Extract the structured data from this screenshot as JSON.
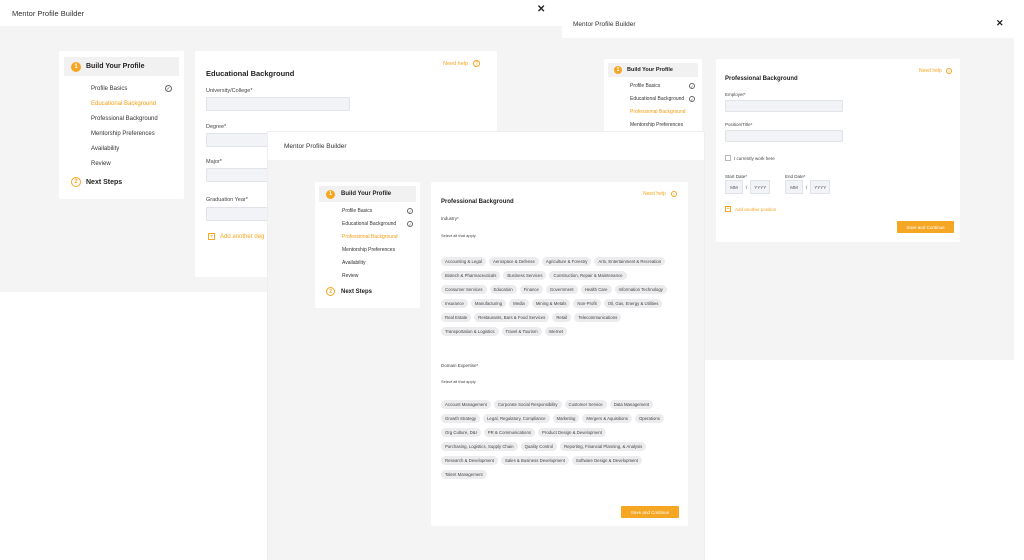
{
  "app_title": "Mentor Profile Builder",
  "close_glyph": "✕",
  "steps": {
    "build": "Build Your Profile",
    "build_num": "1",
    "next": "Next Steps",
    "next_num": "2",
    "items": [
      "Profile Basics",
      "Educational Background",
      "Professional Background",
      "Mentorship Preferences",
      "Availability",
      "Review"
    ]
  },
  "help": "Need help",
  "help_glyph": "?",
  "check_glyph": "✓",
  "plus_glyph": "+",
  "edu": {
    "title": "Educational Background",
    "university": "University/College*",
    "degree": "Degree*",
    "major": "Major*",
    "grad_year": "Graduation Year*",
    "add": "Add another deg"
  },
  "prof": {
    "title": "Professional Background",
    "industry": "Industry*",
    "select_all": "Select all that apply",
    "industries": [
      "Accounting & Legal",
      "Aerospace & Defense",
      "Agriculture & Forestry",
      "Arts, Entertainment & Recreation",
      "Biotech & Pharmaceuticals",
      "Business Services",
      "Construction, Repair & Maintenance",
      "Consumer Services",
      "Education",
      "Finance",
      "Government",
      "Health Care",
      "Information Technology",
      "Insurance",
      "Manufacturing",
      "Media",
      "Mining & Metals",
      "Non-Profit",
      "Oil, Gas, Energy & Utilities",
      "Real Estate",
      "Restaurants, Bars & Food Services",
      "Retail",
      "Telecommunications",
      "Transportation & Logistics",
      "Travel & Tourism",
      "Internet"
    ],
    "domain": "Domain Expertise*",
    "domains": [
      "Account Management",
      "Corporate Social Responsibility",
      "Customer Service",
      "Data Management",
      "Growth Strategy",
      "Legal, Regulatory, Compliance",
      "Marketing",
      "Mergers & Aquisitions",
      "Operations",
      "Org Culture, D&I",
      "PR & Communications",
      "Product Design & Development",
      "Purchasing, Logistics, Supply Chain",
      "Quality Control",
      "Reporting, Financial Planning, & Analysis",
      "Research & Development",
      "Sales & Business Development",
      "Software Design & Development",
      "Talent Management"
    ],
    "save": "Save and Continue"
  },
  "prof2": {
    "title": "Professional Background",
    "employer": "Employer*",
    "position": "Position/Title*",
    "current": "I currently work here",
    "start": "Start Date*",
    "end": "End Date*",
    "mm": "MM",
    "slash": "/",
    "yyyy": "YYYY",
    "add": "Add another position",
    "save": "Save and Continue"
  }
}
